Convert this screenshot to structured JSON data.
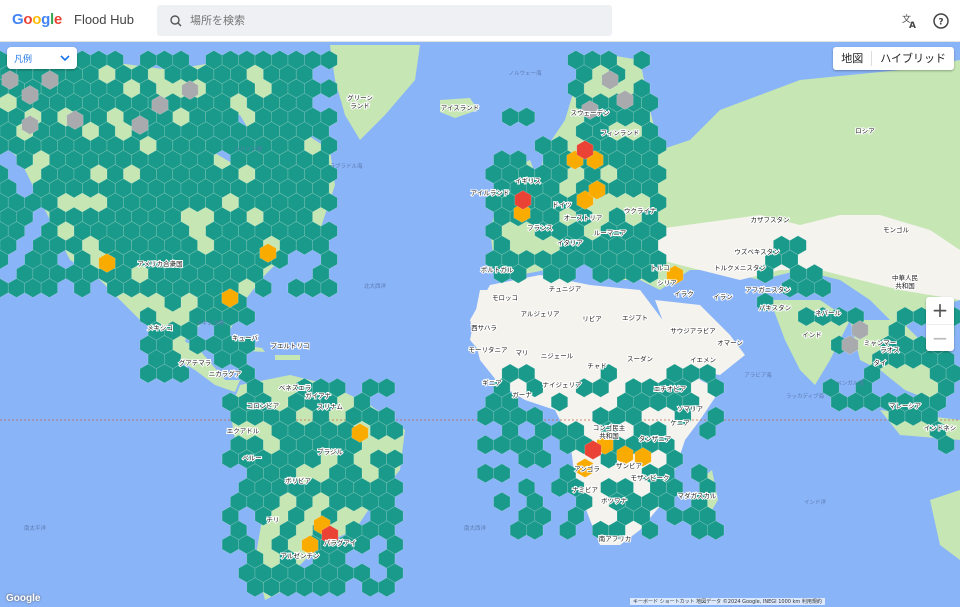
{
  "header": {
    "brand": "Google",
    "brand_colors": [
      "#4285F4",
      "#EA4335",
      "#FBBC05",
      "#4285F4",
      "#34A853",
      "#EA4335"
    ],
    "product": "Flood Hub",
    "search_placeholder": "場所を検索",
    "translate_icon": "translate-icon",
    "help_icon": "help-icon"
  },
  "controls": {
    "legend_label": "凡例",
    "map_types": [
      "地図",
      "ハイブリッド"
    ],
    "zoom_in": "+",
    "zoom_out": "−"
  },
  "colors": {
    "water": "#8ab4f8",
    "land": "#c6e6b4",
    "dry_land": "#f5f3ee",
    "hex_normal": "#1a9a8a",
    "hex_warning": "#f9ab00",
    "hex_danger": "#ea4335",
    "hex_nodata": "#a8aaad"
  },
  "labels": {
    "greenland": "グリーン\nランド",
    "iceland": "アイスランド",
    "norway_sea": "ノルウェー海",
    "hudson": "ハドソン湾",
    "labrador": "ラブラドル海",
    "usa": "アメリカ合衆国",
    "mexico": "メキシコ",
    "gulf": "メキシコ湾",
    "cuba": "キューバ",
    "puerto": "プエルトリコ",
    "n_atlantic": "北大西洋",
    "ireland": "アイルランド",
    "uk": "イギリス",
    "germany": "ドイツ",
    "france": "フランス",
    "austria": "オーストリア",
    "ukraine": "ウクライナ",
    "romania": "ルーマニア",
    "italy": "イタリア",
    "portugal": "ポルトガル",
    "russia": "ロシア",
    "sweden": "スウェーデン",
    "finland": "フィンランド",
    "kazakh": "カザフスタン",
    "mongolia": "モンゴル",
    "uzbek": "ウズベキスタン",
    "turkmen": "トルクメニスタン",
    "china": "中華人民\n共和国",
    "afghan": "アフガニスタン",
    "iran": "イラン",
    "iraq": "イラク",
    "syria": "シリア",
    "turkey": "トルコ",
    "tunisia": "チュニジア",
    "morocco": "モロッコ",
    "algeria": "アルジェリア",
    "libya": "リビア",
    "egypt": "エジプト",
    "wsahara": "西サハラ",
    "mauritania": "モーリタニア",
    "mali": "マリ",
    "niger": "ニジェール",
    "chad": "チャド",
    "sudan": "スーダン",
    "saudi": "サウジアラビア",
    "oman": "オマーン",
    "yemen": "イエメン",
    "ethiopia": "エチオピア",
    "somalia": "ソマリア",
    "ghana": "ガーナ",
    "nigeria": "ナイジェリア",
    "guinea": "ギニア",
    "congo": "コンゴ民主\n共和国",
    "tanzania": "タンザニア",
    "angola": "アンゴラ",
    "zambia": "ザンビア",
    "namibia": "ナミビア",
    "botswana": "ボツワナ",
    "madagascar": "マダガスカル",
    "s_africa": "南アフリカ",
    "kenya": "ケニア",
    "pakistan": "パキスタン",
    "nepal": "ネパール",
    "india": "インド",
    "bengal": "ベンガル湾",
    "arabian": "アラビア海",
    "laccadive": "ラッカディブ海",
    "myanmar": "ミャンマー",
    "malaysia": "マレーシア",
    "indonesia": "インドネシ",
    "indian_ocean": "インド洋",
    "s_atlantic": "南大西洋",
    "s_pacific": "南太平洋",
    "venezuela": "ベネズエラ",
    "guyana": "ガイアナ",
    "suriname": "スリナム",
    "colombia": "コロンビア",
    "ecuador": "エクアドル",
    "peru": "ペルー",
    "brazil": "ブラジル",
    "bolivia": "ボリビア",
    "chile": "チリ",
    "argentina": "アルゼンチン",
    "paraguay": "パラグアイ",
    "guatemala": "グアテマラ",
    "nicaragua": "ニカラグア",
    "mozambique": "モザンビーク",
    "thailand": "タイ",
    "laos": "ラオス"
  },
  "footer": {
    "google": "Google",
    "attribution": "キーボード ショートカット    地図データ ©2024 Google, INEGI    1000 km          利用規約"
  }
}
